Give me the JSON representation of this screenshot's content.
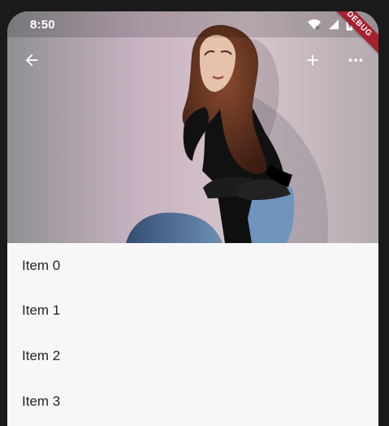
{
  "status_bar": {
    "time": "8:50",
    "icons": [
      "wifi-icon",
      "signal-icon",
      "battery-icon"
    ]
  },
  "app_bar": {
    "back_icon": "arrow-back-icon",
    "actions": [
      "add-icon",
      "more-horizontal-icon"
    ]
  },
  "debug_banner": "DEBUG",
  "list": {
    "items": [
      "Item 0",
      "Item 1",
      "Item 2",
      "Item 3"
    ]
  },
  "colors": {
    "list_background": "#f7f7f7",
    "debug_banner": "#a6222e"
  }
}
